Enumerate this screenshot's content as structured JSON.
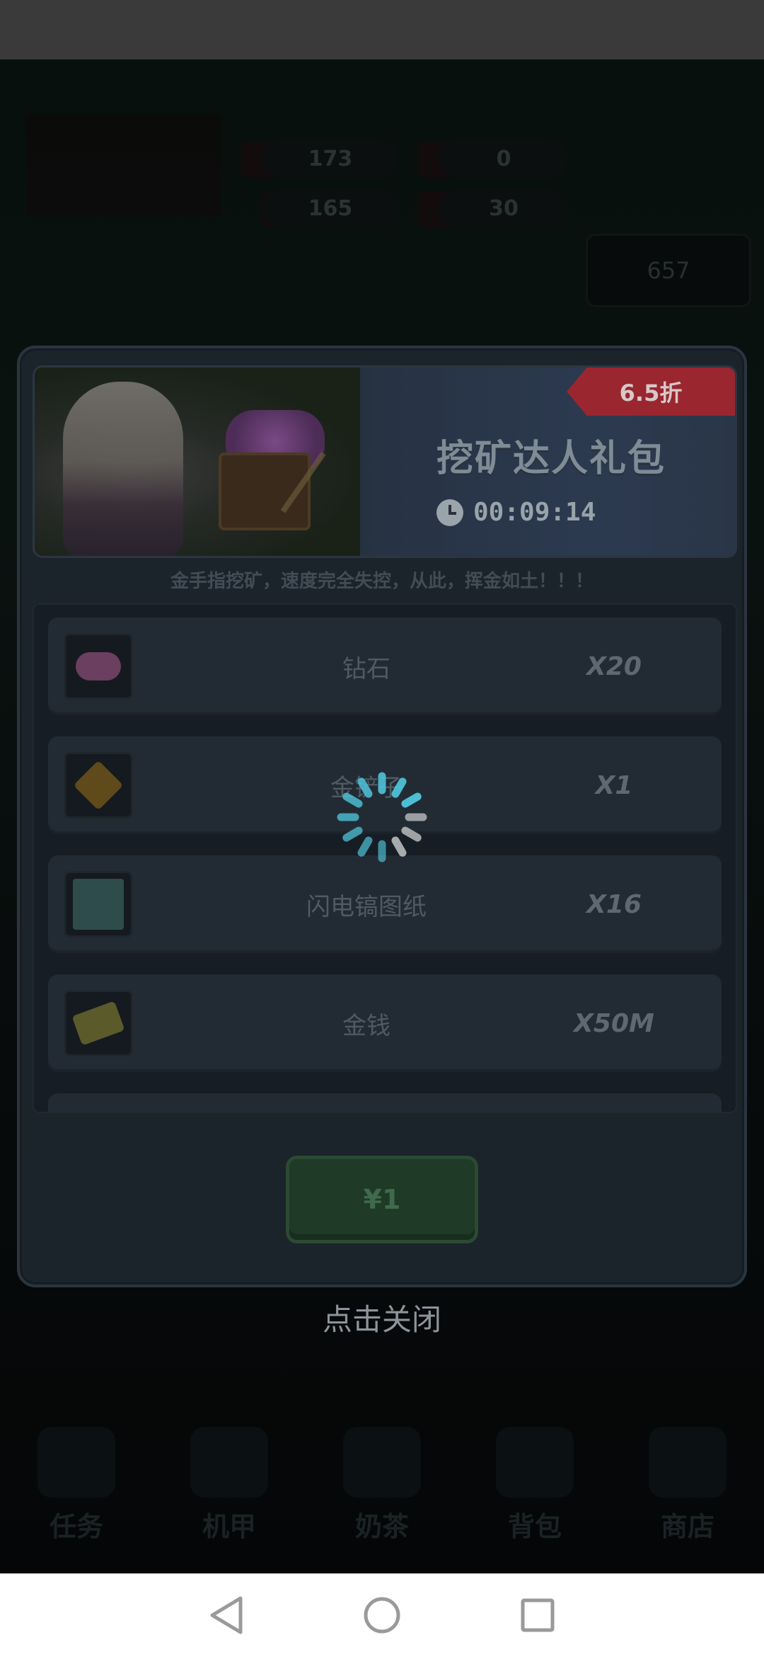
{
  "background": {
    "resources": [
      "173",
      "0",
      "165",
      "30"
    ],
    "side_button_label": "657",
    "nav_tabs": [
      "任务",
      "机甲",
      "奶茶",
      "背包",
      "商店"
    ]
  },
  "popup": {
    "discount": "6.5折",
    "title": "挖矿达人礼包",
    "timer": "00:09:14",
    "description": "金手指挖矿，速度完全失控，从此，挥金如土！！！",
    "items": [
      {
        "name": "钻石",
        "quantity": "X20",
        "icon": "diamond-icon"
      },
      {
        "name": "金铲子",
        "quantity": "X1",
        "icon": "shovel-icon"
      },
      {
        "name": "闪电镐图纸",
        "quantity": "X16",
        "icon": "blueprint-icon"
      },
      {
        "name": "金钱",
        "quantity": "X50M",
        "icon": "money-icon"
      }
    ],
    "buy_label": "¥1"
  },
  "close_hint": "点击关闭",
  "colors": {
    "spinner": "#4fc3d9",
    "discount_ribbon": "#9a2630",
    "buy_button": "#1f3a27"
  }
}
